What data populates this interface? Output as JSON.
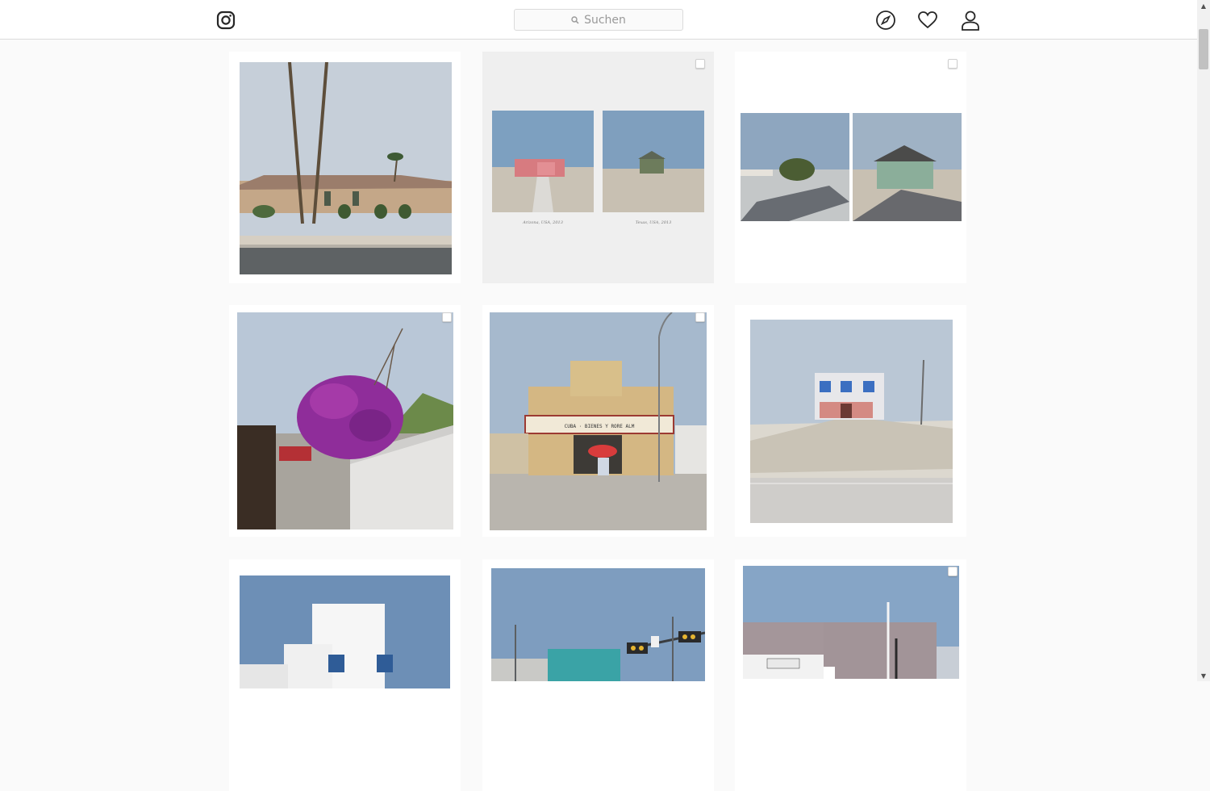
{
  "header": {
    "search": {
      "placeholder": "Suchen"
    },
    "icons": [
      "instagram-logo-icon",
      "search-icon",
      "explore-compass-icon",
      "heart-icon",
      "profile-icon"
    ]
  },
  "grid": {
    "tiles": [
      {
        "id": "palm-trees-house",
        "has_checkbox": false
      },
      {
        "id": "diptych-pink-green-houses",
        "has_checkbox": true,
        "captions": [
          "Arizona, USA, 2013",
          "Texas, USA, 2013"
        ]
      },
      {
        "id": "diptych-tree-shadows",
        "has_checkbox": true
      },
      {
        "id": "bougainvillea-wall",
        "has_checkbox": true
      },
      {
        "id": "cinema-facade",
        "has_checkbox": true,
        "marquee": "CUBA · BIENES Y RORE ALM"
      },
      {
        "id": "house-on-sand",
        "has_checkbox": false
      },
      {
        "id": "white-building-blue-windows",
        "has_checkbox": false
      },
      {
        "id": "traffic-lights-teal-building",
        "has_checkbox": false
      },
      {
        "id": "grey-building-street-lamp",
        "has_checkbox": true
      }
    ]
  },
  "colors": {
    "sky": "#a9b8c9",
    "ground": "#d8d2c6",
    "background": "#fafafa",
    "border": "#dbdbdb"
  }
}
